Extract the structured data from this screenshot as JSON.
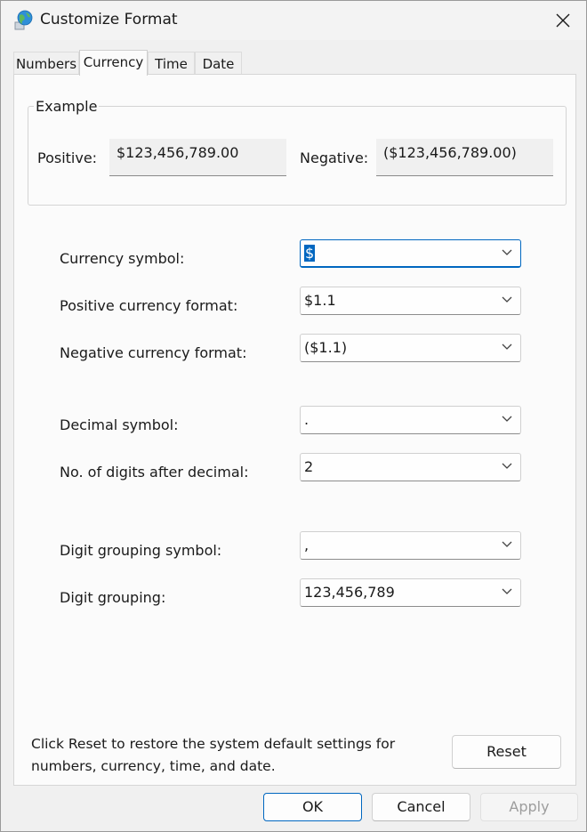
{
  "window": {
    "title": "Customize Format"
  },
  "tabs": [
    {
      "label": "Numbers",
      "active": false
    },
    {
      "label": "Currency",
      "active": true
    },
    {
      "label": "Time",
      "active": false
    },
    {
      "label": "Date",
      "active": false
    }
  ],
  "example": {
    "legend": "Example",
    "positive_label": "Positive:",
    "positive_value": "$123,456,789.00",
    "negative_label": "Negative:",
    "negative_value": "($123,456,789.00)"
  },
  "fields": {
    "currency_symbol": {
      "label": "Currency symbol:",
      "value": "$"
    },
    "positive_format": {
      "label": "Positive currency format:",
      "value": "$1.1"
    },
    "negative_format": {
      "label": "Negative currency format:",
      "value": "($1.1)"
    },
    "decimal_symbol": {
      "label": "Decimal symbol:",
      "value": "."
    },
    "digits_after_decimal": {
      "label": "No. of digits after decimal:",
      "value": "2"
    },
    "grouping_symbol": {
      "label": "Digit grouping symbol:",
      "value": ","
    },
    "digit_grouping": {
      "label": "Digit grouping:",
      "value": "123,456,789"
    }
  },
  "reset_note": "Click Reset to restore the system default settings for numbers, currency, time, and date.",
  "buttons": {
    "reset": "Reset",
    "ok": "OK",
    "cancel": "Cancel",
    "apply": "Apply"
  },
  "colors": {
    "accent": "#0067c0",
    "disabled_text": "#9d9d9d"
  },
  "icons": {
    "app": "globe-icon",
    "close": "close-icon",
    "dropdown": "chevron-down-icon"
  }
}
